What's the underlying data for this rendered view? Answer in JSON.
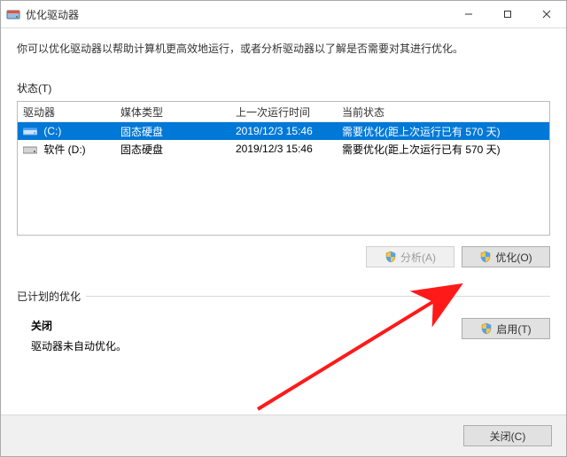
{
  "window": {
    "title": "优化驱动器"
  },
  "description": "你可以优化驱动器以帮助计算机更高效地运行，或者分析驱动器以了解是否需要对其进行优化。",
  "status_label": "状态(T)",
  "columns": {
    "drive": "驱动器",
    "media": "媒体类型",
    "last": "上一次运行时间",
    "status": "当前状态"
  },
  "rows": [
    {
      "drive": "(C:)",
      "media": "固态硬盘",
      "last": "2019/12/3 15:46",
      "status": "需要优化(距上次运行已有 570 天)",
      "selected": true,
      "icon": "drive-ssd"
    },
    {
      "drive": "软件 (D:)",
      "media": "固态硬盘",
      "last": "2019/12/3 15:46",
      "status": "需要优化(距上次运行已有 570 天)",
      "selected": false,
      "icon": "drive-hdd"
    }
  ],
  "buttons": {
    "analyze": "分析(A)",
    "optimize": "优化(O)",
    "turn_on": "启用(T)",
    "close": "关闭(C)"
  },
  "schedule": {
    "section": "已计划的优化",
    "state": "关闭",
    "note": "驱动器未自动优化。"
  }
}
